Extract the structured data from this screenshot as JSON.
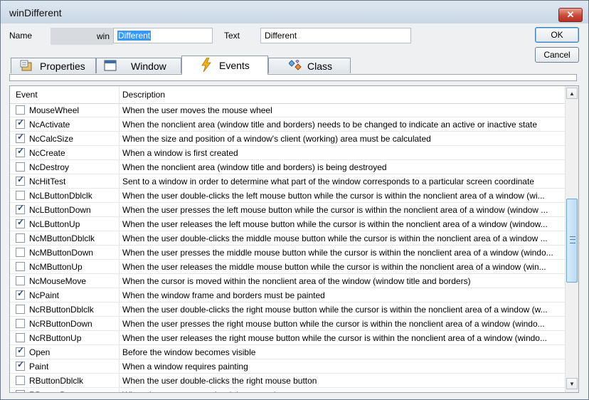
{
  "window": {
    "title": "winDifferent",
    "close_glyph": "✕"
  },
  "form": {
    "name_label": "Name",
    "prefix": "win",
    "name_value": "Different",
    "text_label": "Text",
    "text_value": "Different"
  },
  "buttons": {
    "ok": "OK",
    "cancel": "Cancel"
  },
  "tabs": [
    {
      "label": "Properties",
      "icon": "properties-icon"
    },
    {
      "label": "Window",
      "icon": "window-icon"
    },
    {
      "label": "Events",
      "icon": "lightning-icon",
      "active": true
    },
    {
      "label": "Class",
      "icon": "class-icon"
    }
  ],
  "grid": {
    "columns": [
      "Event",
      "Description"
    ],
    "rows": [
      {
        "event": "MouseWheel",
        "checked": false,
        "desc": "When the user moves the mouse wheel"
      },
      {
        "event": "NcActivate",
        "checked": true,
        "desc": "When the nonclient area (window title and borders) needs to be changed to indicate an active or inactive state"
      },
      {
        "event": "NcCalcSize",
        "checked": true,
        "desc": "When the size and position of a window's client (working) area must be calculated"
      },
      {
        "event": "NcCreate",
        "checked": true,
        "desc": "When a window is first created"
      },
      {
        "event": "NcDestroy",
        "checked": false,
        "desc": "When the nonclient area (window title and borders) is being destroyed"
      },
      {
        "event": "NcHitTest",
        "checked": true,
        "desc": "Sent to a window in order to determine what part of the window corresponds to a particular screen coordinate"
      },
      {
        "event": "NcLButtonDblclk",
        "checked": false,
        "desc": "When the user double-clicks the left mouse button while the cursor is within the nonclient area of a window (wi..."
      },
      {
        "event": "NcLButtonDown",
        "checked": true,
        "desc": "When the user presses the left mouse button while the cursor is within the nonclient area of a window (window ..."
      },
      {
        "event": "NcLButtonUp",
        "checked": true,
        "desc": "When the user releases the left mouse button while the cursor is within the nonclient area of a window (window..."
      },
      {
        "event": "NcMButtonDblclk",
        "checked": false,
        "desc": "When the user double-clicks the middle mouse button while the cursor is within the nonclient area of a window ..."
      },
      {
        "event": "NcMButtonDown",
        "checked": false,
        "desc": "When the user presses the middle mouse button while the cursor is within the nonclient area of a window (windo..."
      },
      {
        "event": "NcMButtonUp",
        "checked": false,
        "desc": "When the user releases the middle mouse button while the cursor is within the nonclient area of a window (win..."
      },
      {
        "event": "NcMouseMove",
        "checked": false,
        "desc": "When the cursor is moved within the nonclient area of the window (window title and borders)"
      },
      {
        "event": "NcPaint",
        "checked": true,
        "desc": "When the window frame and borders must be painted"
      },
      {
        "event": "NcRButtonDblclk",
        "checked": false,
        "desc": "When the user double-clicks the right mouse button while the cursor is within the nonclient area of a window (w..."
      },
      {
        "event": "NcRButtonDown",
        "checked": false,
        "desc": "When the user presses the right mouse button while the cursor is within the nonclient area of a window (windo..."
      },
      {
        "event": "NcRButtonUp",
        "checked": false,
        "desc": "When the user releases the right mouse button while the cursor is within the nonclient area of a window (windo..."
      },
      {
        "event": "Open",
        "checked": true,
        "desc": "Before the window becomes visible"
      },
      {
        "event": "Paint",
        "checked": true,
        "desc": "When a window requires painting"
      },
      {
        "event": "RButtonDblclk",
        "checked": false,
        "desc": "When the user double-clicks the right mouse button"
      },
      {
        "event": "RButtonDown",
        "checked": false,
        "desc": "When the user presses the right mouse button"
      }
    ]
  },
  "scrollbar": {
    "up_glyph": "▲",
    "down_glyph": "▼"
  },
  "colors": {
    "selection": "#3399ff",
    "close": "#c9493a",
    "thumb": "#b9dbf6"
  }
}
